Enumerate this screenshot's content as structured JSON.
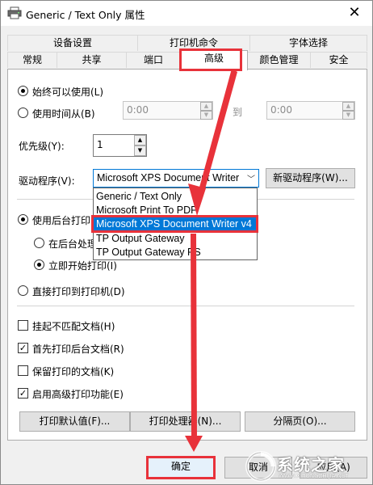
{
  "window": {
    "title": "Generic / Text Only 属性",
    "close_label": "✕"
  },
  "tabs": {
    "row1": [
      "设备设置",
      "打印机命令",
      "字体选择"
    ],
    "row2": [
      "常规",
      "共享",
      "端口",
      "高级",
      "颜色管理",
      "安全"
    ],
    "selected": "高级"
  },
  "availability": {
    "always_label": "始终可以使用(L)",
    "from_label": "使用时间从(B)",
    "from_time": "0:00",
    "to_label": "到",
    "to_time": "0:00"
  },
  "priority": {
    "label": "优先级(Y):",
    "value": "1"
  },
  "driver": {
    "label": "驱动程序(V):",
    "selected": "Microsoft XPS Document Writer v4",
    "new_driver_button": "新驱动程序(W)...",
    "options": [
      "Generic / Text Only",
      "Microsoft Print To PDF",
      "Microsoft XPS Document Writer v4",
      "TP Output Gateway",
      "TP Output Gateway PS"
    ]
  },
  "spooling": {
    "spool_label": "使用后台打印",
    "after_last_page_label": "在后台处理",
    "start_immediately_label": "立即开始打印(I)",
    "direct_label": "直接打印到打印机(D)"
  },
  "options": {
    "hold_mismatched_label": "挂起不匹配文档(H)",
    "print_spooled_first_label": "首先打印后台文档(R)",
    "keep_printed_label": "保留打印的文档(K)",
    "advanced_features_label": "启用高级打印功能(E)"
  },
  "lower_buttons": {
    "defaults": "打印默认值(F)...",
    "processor": "打印处理器(N)...",
    "separator": "分隔页(O)..."
  },
  "footer": {
    "ok": "确定",
    "cancel": "取消",
    "apply": "应用(A)"
  },
  "colors": {
    "accent": "#0078d7",
    "highlight_box": "#e8323a"
  },
  "watermark": {
    "text": "系统之家",
    "url": "WWW.XITONGZHIJIA.NET"
  }
}
